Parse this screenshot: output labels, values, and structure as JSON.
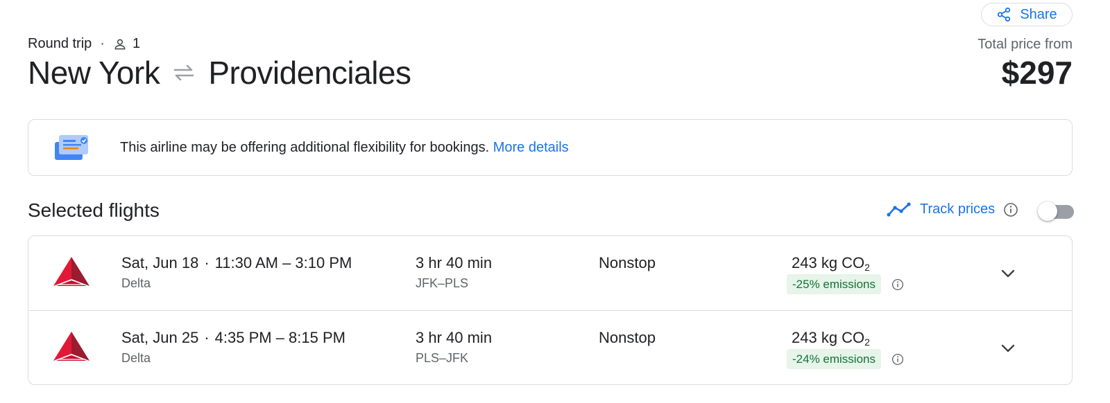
{
  "header": {
    "share_label": "Share",
    "trip_type": "Round trip",
    "passengers": "1",
    "origin": "New York",
    "destination": "Providenciales",
    "price_label": "Total price from",
    "price": "$297"
  },
  "notice": {
    "text": "This airline may be offering additional flexibility for bookings.",
    "link": "More details"
  },
  "selected": {
    "title": "Selected flights",
    "track_label": "Track prices",
    "track_enabled": false
  },
  "flights": [
    {
      "date": "Sat, Jun 18",
      "time": "11:30 AM – 3:10 PM",
      "airline": "Delta",
      "duration": "3 hr 40 min",
      "airports": "JFK–PLS",
      "stops": "Nonstop",
      "co2_value": "243 kg CO",
      "co2_sub": "2",
      "emissions": "-25% emissions"
    },
    {
      "date": "Sat, Jun 25",
      "time": "4:35 PM – 8:15 PM",
      "airline": "Delta",
      "duration": "3 hr 40 min",
      "airports": "PLS–JFK",
      "stops": "Nonstop",
      "co2_value": "243 kg CO",
      "co2_sub": "2",
      "emissions": "-24% emissions"
    }
  ],
  "colors": {
    "accent": "#1a73e8",
    "emissions_bg": "#e6f4ea",
    "emissions_text": "#137333",
    "delta_red": "#c8102e"
  },
  "icons": [
    "share-icon",
    "person-icon",
    "swap-arrows-icon",
    "flexibility-ticket-icon",
    "trend-line-icon",
    "info-icon",
    "delta-logo",
    "chevron-down-icon"
  ]
}
